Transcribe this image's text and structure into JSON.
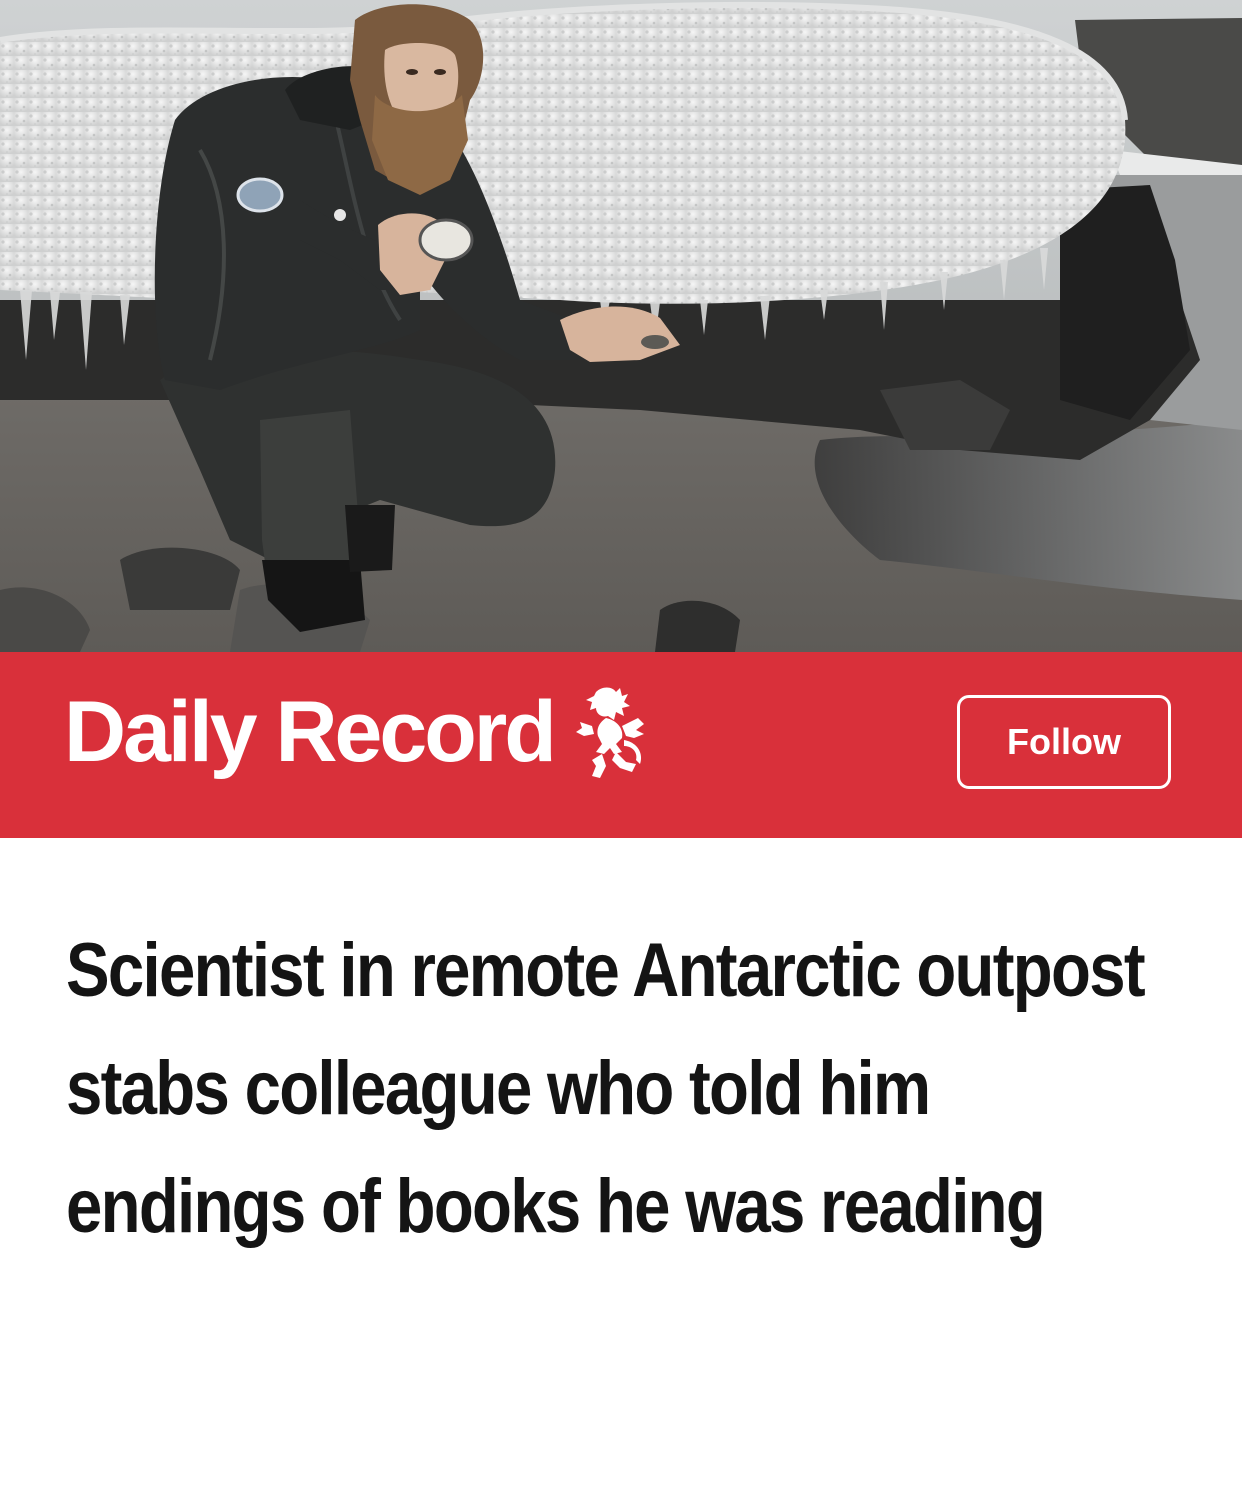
{
  "hero": {
    "photo": "scientist-crouching-on-antarctic-beach-photo"
  },
  "brand": {
    "name": "Daily Record",
    "emblem": "rampant-lion-icon",
    "follow_label": "Follow",
    "color": "#d9303a"
  },
  "article": {
    "headline": "Scientist in remote Antarctic outpost stabs colleague who told him endings of books he was reading"
  }
}
